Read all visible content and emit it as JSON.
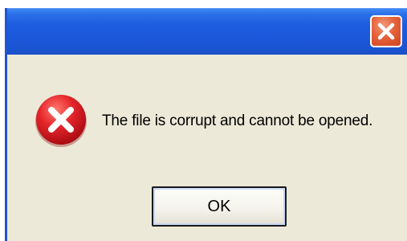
{
  "dialog": {
    "message": "The file is corrupt and cannot be opened.",
    "ok_label": "OK",
    "icons": {
      "close": "close-icon",
      "status": "error-icon"
    },
    "colors": {
      "titlebar": "#1d5ce0",
      "body": "#ece9d8",
      "close_button": "#e4623b",
      "error_icon": "#d8141c"
    }
  }
}
